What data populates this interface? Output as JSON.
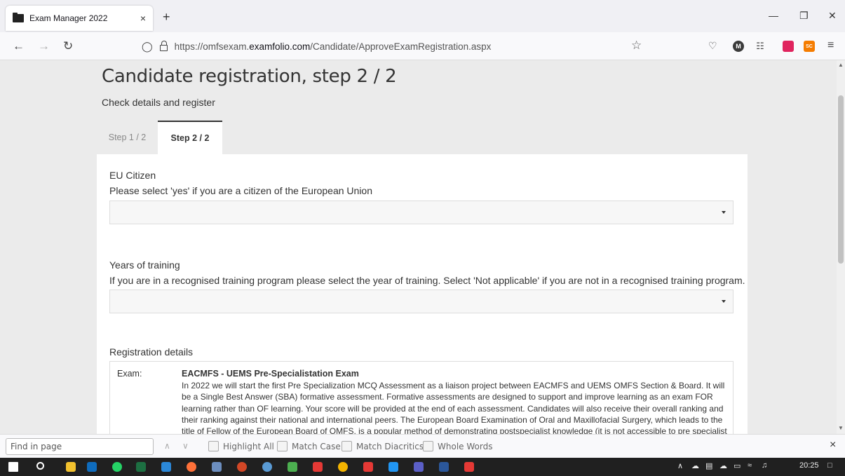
{
  "browser": {
    "tab_title": "Exam Manager 2022",
    "tab_close": "×",
    "new_tab": "+",
    "url_prefix": "https://omfsexam.",
    "url_domain": "examfolio.com",
    "url_path": "/Candidate/ApproveExamRegistration.aspx",
    "icons": [
      "back-icon",
      "forward-icon",
      "reload-icon",
      "shield-icon",
      "lock-icon",
      "star-icon",
      "pocket-icon",
      "menu-icon"
    ],
    "extensions": [
      {
        "name": "m-extension",
        "label": "M",
        "color": "#3b3b3b"
      },
      {
        "name": "bars-extension",
        "label": "",
        "color": "#444444"
      },
      {
        "name": "red-extension",
        "label": "",
        "color": "#e0245e"
      },
      {
        "name": "sc-extension",
        "label": "SC",
        "color": "#f57c00"
      }
    ]
  },
  "page": {
    "title": "Candidate registration, step 2 / 2",
    "subtitle": "Check details and register",
    "tabs": [
      {
        "label": "Step 1 / 2",
        "active": false
      },
      {
        "label": "Step 2 / 2",
        "active": true
      }
    ],
    "fields": [
      {
        "title": "EU Citizen",
        "help": "Please select 'yes' if you are a citizen of the European Union",
        "value": ""
      },
      {
        "title": "Years of training",
        "help": "If you are in a recognised training program please select the year of training. Select 'Not applicable' if you are not in a recognised training program.",
        "value": ""
      }
    ],
    "registration": {
      "heading": "Registration details",
      "exam_label": "Exam:",
      "exam_name": "EACMFS - UEMS Pre-Specialistation Exam",
      "exam_description": "In 2022 we will start the first Pre Specialization MCQ Assessment as a liaison project between EACMFS and UEMS OMFS Section & Board. It will be a Single Best Answer (SBA) formative assessment. Formative assessments are designed to support and improve learning as an exam FOR learning rather than OF learning. Your score will be provided at the end of each assessment. Candidates will also receive their overall ranking and their ranking against their national and international peers. The European Board Examination of Oral and Maxillofacial Surgery, which leads to the title of Fellow of the European Board of OMFS, is a popular method of demonstrating postspecialist knowledge (it is not accessible to pre specialist trainees). This"
    }
  },
  "findbar": {
    "placeholder": "Find in page",
    "options": [
      "Highlight All",
      "Match Case",
      "Match Diacritics",
      "Whole Words"
    ],
    "close": "×"
  },
  "taskbar": {
    "time": "20:25",
    "apps": [
      {
        "name": "start-icon",
        "color": "#ffffff"
      },
      {
        "name": "search-icon",
        "color": "#ffffff"
      },
      {
        "name": "file-explorer-icon",
        "color": "#f2c12e"
      },
      {
        "name": "outlook-icon",
        "color": "#0f6cbd"
      },
      {
        "name": "whatsapp-icon",
        "color": "#25d366"
      },
      {
        "name": "excel-icon",
        "color": "#1d6f42"
      },
      {
        "name": "app-a-icon",
        "color": "#2b88d8"
      },
      {
        "name": "firefox-icon",
        "color": "#ff7139"
      },
      {
        "name": "app-grid-icon",
        "color": "#6c8ebf"
      },
      {
        "name": "powerpoint-icon",
        "color": "#d24726"
      },
      {
        "name": "app-circle-icon",
        "color": "#5a9bd5"
      },
      {
        "name": "app-tree-icon",
        "color": "#4caf50"
      },
      {
        "name": "acrobat-icon",
        "color": "#e53935"
      },
      {
        "name": "chrome-icon",
        "color": "#f4b400"
      },
      {
        "name": "app-m-icon",
        "color": "#e53935"
      },
      {
        "name": "media-icon",
        "color": "#2196f3"
      },
      {
        "name": "teams-icon",
        "color": "#5b5fc7"
      },
      {
        "name": "word-icon",
        "color": "#2b579a"
      },
      {
        "name": "pdf-icon",
        "color": "#e53935"
      }
    ]
  }
}
